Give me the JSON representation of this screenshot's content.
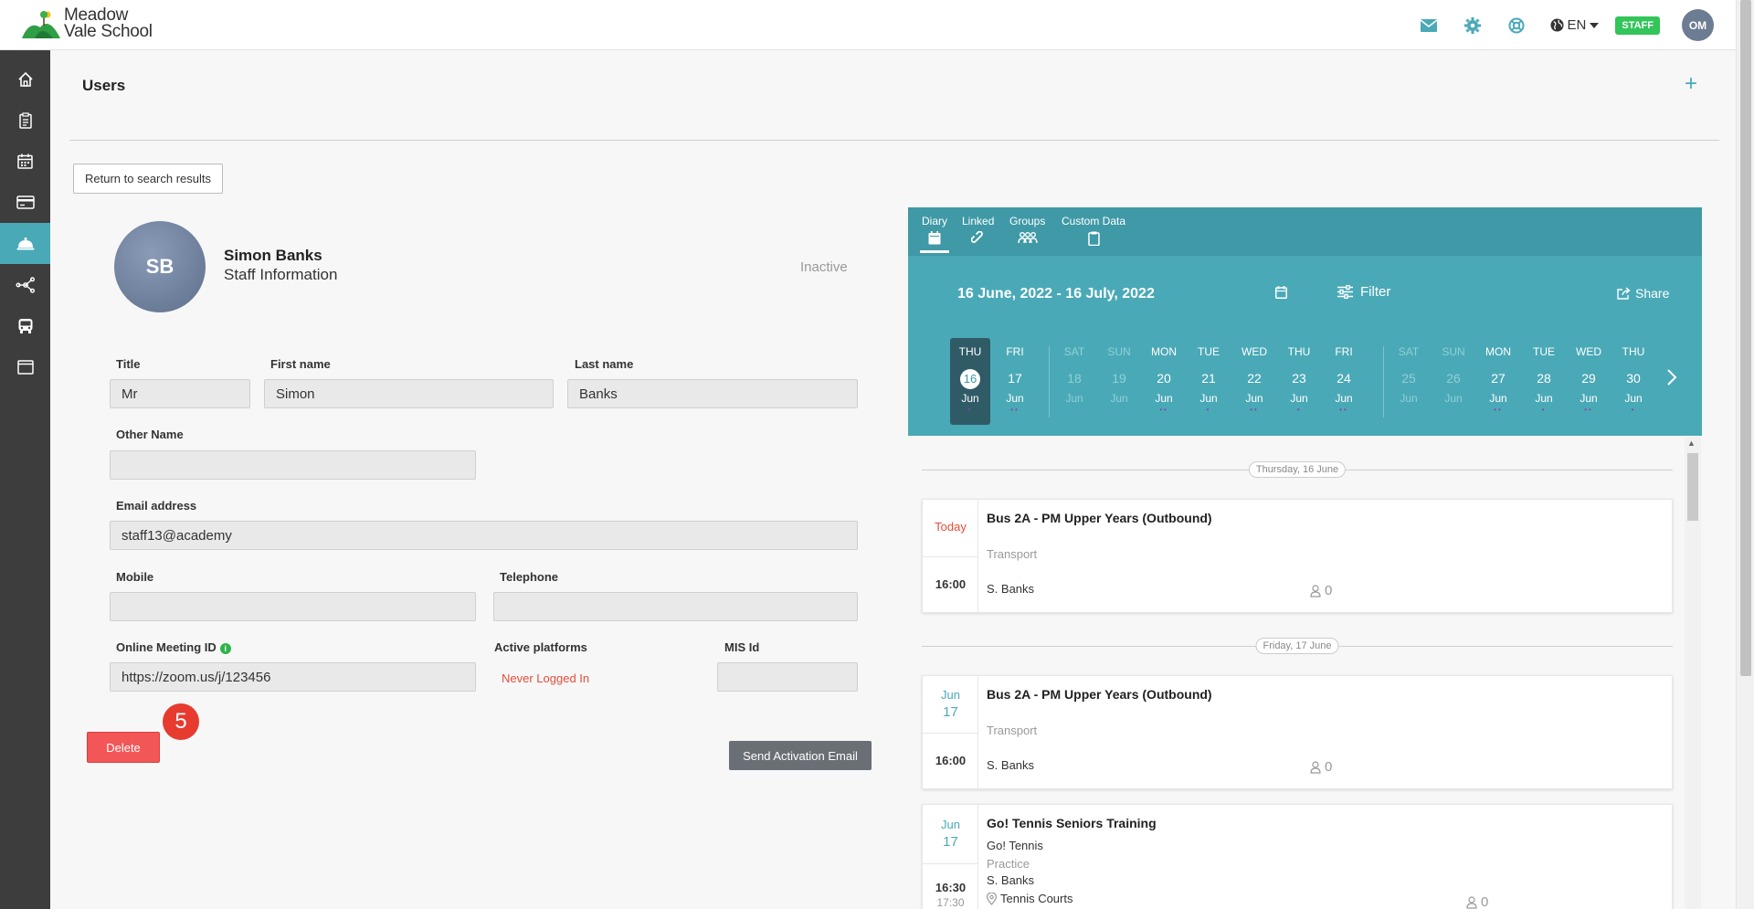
{
  "app": {
    "logo_line1": "Meadow",
    "logo_line2": "Vale School",
    "lang": "EN",
    "staff_badge": "STAFF",
    "user_initials": "OM"
  },
  "colors": {
    "accent": "#4aa9b7",
    "sidebar": "#3d3d3d",
    "danger": "#f35656",
    "badge_green": "#33c45a"
  },
  "sidebar": {
    "items": [
      {
        "icon": "home-icon"
      },
      {
        "icon": "clipboard-icon"
      },
      {
        "icon": "calendar-icon"
      },
      {
        "icon": "card-icon"
      },
      {
        "icon": "cloche-icon",
        "active": true
      },
      {
        "icon": "network-icon"
      },
      {
        "icon": "bus-icon"
      },
      {
        "icon": "window-icon"
      }
    ]
  },
  "page": {
    "title": "Users",
    "add": "+",
    "return_button": "Return to search results"
  },
  "profile": {
    "initials": "SB",
    "name": "Simon Banks",
    "subtitle": "Staff Information",
    "status": "Inactive"
  },
  "form": {
    "title_label": "Title",
    "title_value": "Mr",
    "first_name_label": "First name",
    "first_name_value": "Simon",
    "last_name_label": "Last name",
    "last_name_value": "Banks",
    "other_name_label": "Other Name",
    "other_name_value": "",
    "email_label": "Email address",
    "email_value": "staff13@academy",
    "mobile_label": "Mobile",
    "mobile_value": "",
    "telephone_label": "Telephone",
    "telephone_value": "",
    "meeting_label": "Online Meeting ID",
    "meeting_value": "https://zoom.us/j/123456",
    "platforms_label": "Active platforms",
    "platforms_value": "Never Logged In",
    "mis_label": "MIS Id",
    "mis_value": ""
  },
  "actions": {
    "delete": "Delete",
    "badge": "5",
    "activation": "Send Activation Email"
  },
  "calendar": {
    "tabs": [
      "Diary",
      "Linked",
      "Groups",
      "Custom Data"
    ],
    "range": "16 June, 2022 - 16 July, 2022",
    "filter": "Filter",
    "share": "Share",
    "days": [
      {
        "dow": "THU",
        "num": "16",
        "mon": "Jun",
        "dots": "•",
        "selected": true
      },
      {
        "dow": "FRI",
        "num": "17",
        "mon": "Jun",
        "dots": "••"
      },
      {
        "dow": "SAT",
        "num": "18",
        "mon": "Jun",
        "dots": "",
        "muted": true
      },
      {
        "dow": "SUN",
        "num": "19",
        "mon": "Jun",
        "dots": "",
        "muted": true
      },
      {
        "dow": "MON",
        "num": "20",
        "mon": "Jun",
        "dots": "••"
      },
      {
        "dow": "TUE",
        "num": "21",
        "mon": "Jun",
        "dots": "•"
      },
      {
        "dow": "WED",
        "num": "22",
        "mon": "Jun",
        "dots": "••"
      },
      {
        "dow": "THU",
        "num": "23",
        "mon": "Jun",
        "dots": "•"
      },
      {
        "dow": "FRI",
        "num": "24",
        "mon": "Jun",
        "dots": "••"
      },
      {
        "dow": "SAT",
        "num": "25",
        "mon": "Jun",
        "dots": "",
        "muted": true
      },
      {
        "dow": "SUN",
        "num": "26",
        "mon": "Jun",
        "dots": "",
        "muted": true
      },
      {
        "dow": "MON",
        "num": "27",
        "mon": "Jun",
        "dots": "••"
      },
      {
        "dow": "TUE",
        "num": "28",
        "mon": "Jun",
        "dots": "•"
      },
      {
        "dow": "WED",
        "num": "29",
        "mon": "Jun",
        "dots": "••"
      },
      {
        "dow": "THU",
        "num": "30",
        "mon": "Jun",
        "dots": "•"
      }
    ]
  },
  "events": {
    "divider1": "Thursday, 16 June",
    "divider2": "Friday, 17 June",
    "e1": {
      "when": "Today",
      "time": "16:00",
      "title": "Bus 2A - PM Upper Years (Outbound)",
      "category": "Transport",
      "person": "S. Banks",
      "count": "0"
    },
    "e2": {
      "when_mon": "Jun",
      "when_day": "17",
      "time": "16:00",
      "title": "Bus 2A - PM Upper Years (Outbound)",
      "category": "Transport",
      "person": "S. Banks",
      "count": "0"
    },
    "e3": {
      "when_mon": "Jun",
      "when_day": "17",
      "time": "16:30",
      "time_end": "17:30",
      "title": "Go! Tennis Seniors Training",
      "sub": "Go! Tennis",
      "category": "Practice",
      "person": "S. Banks",
      "location": "Tennis Courts",
      "count": "0"
    }
  }
}
